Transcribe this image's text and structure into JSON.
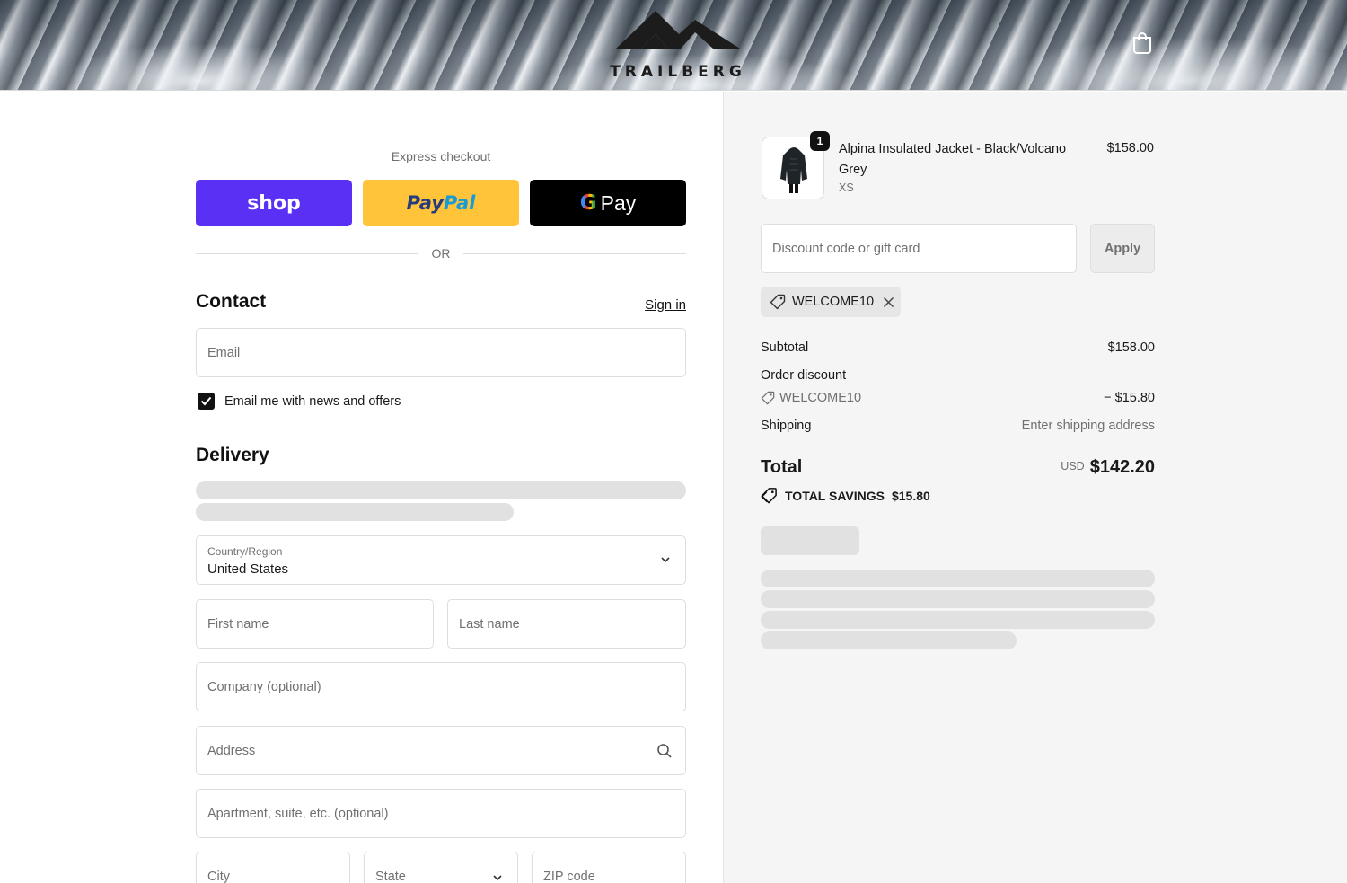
{
  "header": {
    "brand": "TRAILBERG",
    "cart_icon": "shopping-bag-icon"
  },
  "express": {
    "label": "Express checkout",
    "shop_label": "shop",
    "paypal_label_1": "Pay",
    "paypal_label_2": "Pal",
    "gpay_g": "G",
    "gpay_label": "Pay",
    "or_label": "OR"
  },
  "contact": {
    "title": "Contact",
    "sign_in": "Sign in",
    "email_placeholder": "Email",
    "newsletter_label": "Email me with news and offers",
    "newsletter_checked": true
  },
  "delivery": {
    "title": "Delivery",
    "country_label": "Country/Region",
    "country_value": "United States",
    "first_name": "First name",
    "last_name": "Last name",
    "company": "Company (optional)",
    "address": "Address",
    "apartment": "Apartment, suite, etc. (optional)",
    "city": "City",
    "state": "State",
    "zip": "ZIP code"
  },
  "order": {
    "item": {
      "name": "Alpina Insulated Jacket - Black/Volcano Grey",
      "variant": "XS",
      "price": "$158.00",
      "quantity": "1"
    },
    "discount_placeholder": "Discount code or gift card",
    "apply_label": "Apply",
    "applied_code": "WELCOME10",
    "subtotal_label": "Subtotal",
    "subtotal_value": "$158.00",
    "order_discount_label": "Order discount",
    "discount_code": "WELCOME10",
    "discount_value": "− $15.80",
    "shipping_label": "Shipping",
    "shipping_value": "Enter shipping address",
    "total_label": "Total",
    "currency": "USD",
    "total_value": "$142.20",
    "savings_label": "TOTAL SAVINGS",
    "savings_value": "$15.80"
  },
  "colors": {
    "shop": "#5a31f4",
    "paypal": "#ffc439",
    "gpay": "#000000",
    "summary_bg": "#f5f5f5"
  }
}
